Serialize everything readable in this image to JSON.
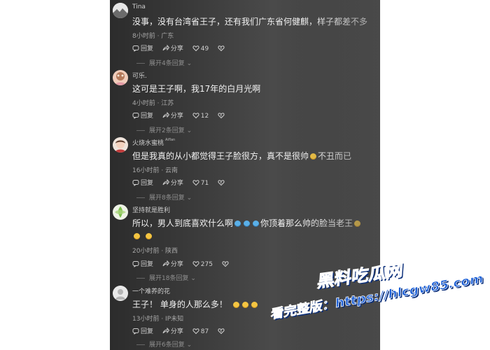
{
  "comments": [
    {
      "name": "Tina",
      "badge": "",
      "text": "没事，没有台湾省王子，还有我们广东省何健麒，样子都差不多",
      "meta": "8小时前 · 广东",
      "reply": "回复",
      "share": "分享",
      "likes": "49",
      "expand": "展开4条回复"
    },
    {
      "name": "可乐.",
      "badge": "",
      "text": "这可是王子啊，我17年的白月光啊",
      "meta": "4小时前 · 江苏",
      "reply": "回复",
      "share": "分享",
      "likes": "12",
      "expand": "展开2条回复"
    },
    {
      "name": "火烧水蜜桃",
      "badge": "Aiflan",
      "text_a": "但是我真的从小都觉得王子脸很方，真不是很帅",
      "text_b": "不丑而已",
      "meta": "16小时前 · 云南",
      "reply": "回复",
      "share": "分享",
      "likes": "71",
      "expand": "展开8条回复"
    },
    {
      "name": "坚持就是胜利",
      "badge": "",
      "text_a": "所以，男人到底喜欢什么啊",
      "text_b": "你顶着那么帅的脸当老王",
      "meta": "20小时前 · 陕西",
      "reply": "回复",
      "share": "分享",
      "likes": "275",
      "expand": "展开18条回复"
    },
    {
      "name": "一个难养的花",
      "badge": "",
      "text": "王子！ 单身的人那么多！",
      "meta": "13小时前 · IP未知",
      "reply": "回复",
      "share": "分享",
      "likes": "87",
      "expand": "展开6条回复"
    }
  ],
  "watermark": {
    "line1": "黑料吃瓜网",
    "line2": "看完整版：https://hlcgw85.com"
  },
  "colors": {
    "panel_bg": "#3a3a3a",
    "text": "#f2f2f2",
    "meta": "#a7a7a7",
    "watermark": "#1b5fd6"
  }
}
